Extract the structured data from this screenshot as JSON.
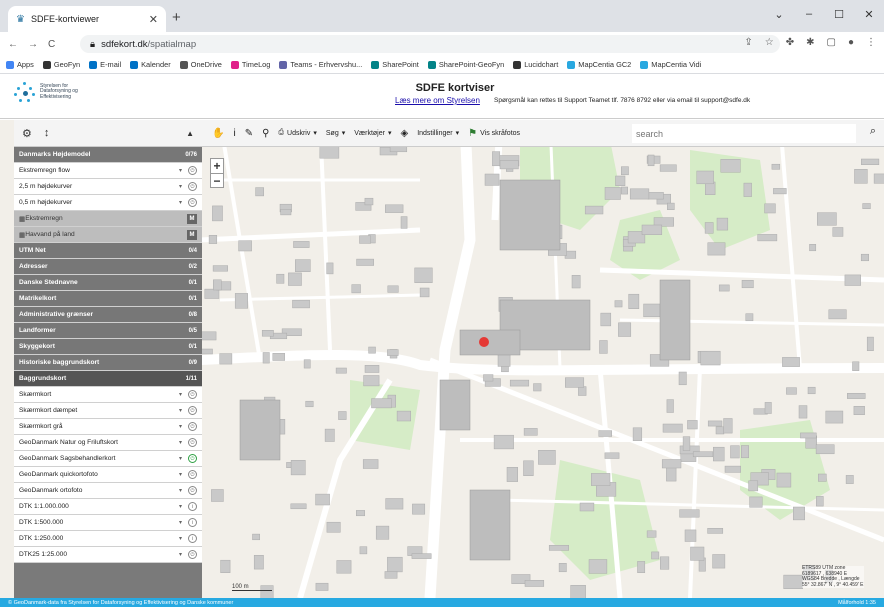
{
  "browser": {
    "tab_title": "SDFE-kortviewer",
    "new_tab": "+",
    "url_host": "sdfekort.dk",
    "url_path": "/spatialmap",
    "window_minimize": "–",
    "window_restore": "☐",
    "window_close": "✕"
  },
  "bookmarks": [
    {
      "label": "Apps",
      "color": "#4285f4"
    },
    {
      "label": "GeoFyn",
      "color": "#333333"
    },
    {
      "label": "E-mail",
      "color": "#0072c6"
    },
    {
      "label": "Kalender",
      "color": "#0072c6"
    },
    {
      "label": "OneDrive",
      "color": "#555555"
    },
    {
      "label": "TimeLog",
      "color": "#e0218a"
    },
    {
      "label": "Teams - Erhvervshu...",
      "color": "#6264a7"
    },
    {
      "label": "SharePoint",
      "color": "#038387"
    },
    {
      "label": "SharePoint-GeoFyn",
      "color": "#038387"
    },
    {
      "label": "Lucidchart",
      "color": "#333333"
    },
    {
      "label": "MapCentia GC2",
      "color": "#29a8e0"
    },
    {
      "label": "MapCentia Vidi",
      "color": "#29a8e0"
    }
  ],
  "header": {
    "logo_text_1": "Styrelsen for",
    "logo_text_2": "Dataforsyning og",
    "logo_text_3": "Effektivisering",
    "title": "SDFE kortviser",
    "link": "Læs mere om Styrelsen",
    "support": "Spørgsmål kan rettes til Support Teamet  tlf. 7876 8792 eller via email til support@sdfe.dk"
  },
  "sidebar": {
    "rows": [
      {
        "type": "head",
        "label": "Danmarks Højdemodel",
        "count": "0/76"
      },
      {
        "type": "layer",
        "label": "Ekstremregn flow",
        "on": false
      },
      {
        "type": "layer",
        "label": "2,5 m højdekurver",
        "on": false
      },
      {
        "type": "layer",
        "label": "0,5 m højdekurver",
        "on": false
      },
      {
        "type": "mlayer",
        "label": "Ekstremregn",
        "badge": "M"
      },
      {
        "type": "mlayer",
        "label": "Havvand på land",
        "badge": "M"
      },
      {
        "type": "head",
        "label": "UTM Net",
        "count": "0/4"
      },
      {
        "type": "head",
        "label": "Adresser",
        "count": "0/2"
      },
      {
        "type": "head",
        "label": "Danske Stednavne",
        "count": "0/1"
      },
      {
        "type": "head",
        "label": "Matrikelkort",
        "count": "0/1"
      },
      {
        "type": "head",
        "label": "Administrative grænser",
        "count": "0/8"
      },
      {
        "type": "head",
        "label": "Landformer",
        "count": "0/5"
      },
      {
        "type": "head",
        "label": "Skyggekort",
        "count": "0/1"
      },
      {
        "type": "head",
        "label": "Historiske baggrundskort",
        "count": "0/9"
      },
      {
        "type": "headdark",
        "label": "Baggrundskort",
        "count": "1/11"
      },
      {
        "type": "layer",
        "label": "Skærmkort",
        "on": false
      },
      {
        "type": "layer",
        "label": "Skærmkort dæmpet",
        "on": false
      },
      {
        "type": "layer",
        "label": "Skærmkort grå",
        "on": false
      },
      {
        "type": "layer",
        "label": "GeoDanmark Natur og Friluftskort",
        "on": false
      },
      {
        "type": "layer",
        "label": "GeoDanmark Sagsbehandlerkort",
        "on": true
      },
      {
        "type": "layer",
        "label": "GeoDanmark quickortofoto",
        "on": false
      },
      {
        "type": "layer",
        "label": "GeoDanmark ortofoto",
        "on": false
      },
      {
        "type": "layer",
        "label": "DTK 1:1.000.000",
        "on": false,
        "info": true
      },
      {
        "type": "layer",
        "label": "DTK 1:500.000",
        "on": false,
        "info": true
      },
      {
        "type": "layer",
        "label": "DTK 1:250.000",
        "on": false,
        "info": true
      },
      {
        "type": "layer",
        "label": "DTK25 1:25.000",
        "on": false
      }
    ]
  },
  "toolbar": {
    "udskriv": "Udskriv",
    "soeg": "Søg",
    "vaerktoejer": "Værktøjer",
    "indstillinger": "Indstillinger",
    "skraafotos": "Vis skråfotos",
    "search_placeholder": "search"
  },
  "map": {
    "scale": "100 m",
    "coord_1": "ETRS89 UTM zone",
    "coord_2": "6189617 , 638940 E",
    "coord_3": "WGS84 Bredde , Længde",
    "coord_4": "55° 32.867' N , 9° 40.459' E",
    "marker_color": "#e53935"
  },
  "footer": {
    "credit": "© GeoDanmark-data fra Styrelsen for Dataforsyning og Effektivisering og Danske kommuner",
    "scale": "Målforhold 1:35"
  }
}
